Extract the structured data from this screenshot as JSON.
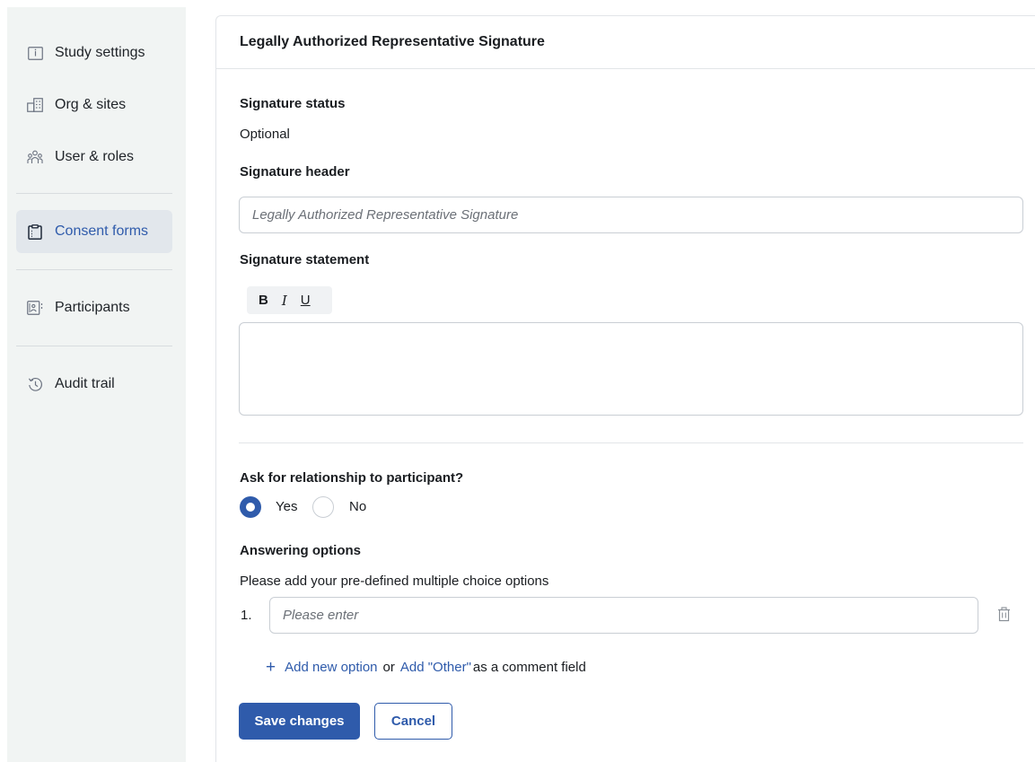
{
  "sidebar": {
    "items": [
      {
        "label": "Study settings",
        "icon": "folder-info-icon"
      },
      {
        "label": "Org & sites",
        "icon": "building-icon"
      },
      {
        "label": "User & roles",
        "icon": "users-icon"
      },
      {
        "label": "Consent forms",
        "icon": "clipboard-icon",
        "active": true
      },
      {
        "label": "Participants",
        "icon": "participant-card-icon"
      },
      {
        "label": "Audit trail",
        "icon": "history-icon"
      }
    ]
  },
  "card": {
    "title": "Legally Authorized Representative Signature",
    "signature_status_label": "Signature status",
    "signature_status_value": "Optional",
    "signature_header_label": "Signature header",
    "signature_header_value": "",
    "signature_header_placeholder": "Legally Authorized Representative Signature",
    "signature_statement_label": "Signature statement",
    "toolbar": {
      "bold": "B",
      "italic": "I",
      "underline": "U"
    },
    "signature_statement_value": "",
    "relationship_question": "Ask for relationship to participant?",
    "radio_yes": "Yes",
    "radio_no": "No",
    "radio_selected": "Yes",
    "answering_options_label": "Answering options",
    "answering_options_help": "Please add your pre-defined multiple choice options",
    "options": [
      {
        "number": "1.",
        "value": "",
        "placeholder": "Please enter"
      }
    ],
    "add_new_option": "Add new option",
    "or_text": "or",
    "add_other": "Add \"Other\"",
    "as_comment_field": "as a comment field",
    "save_button": "Save changes",
    "cancel_button": "Cancel"
  },
  "colors": {
    "accent": "#2f5bab",
    "sidebar_bg": "#f1f4f3",
    "active_bg": "#e2e7ec",
    "border": "#c9ced4"
  }
}
